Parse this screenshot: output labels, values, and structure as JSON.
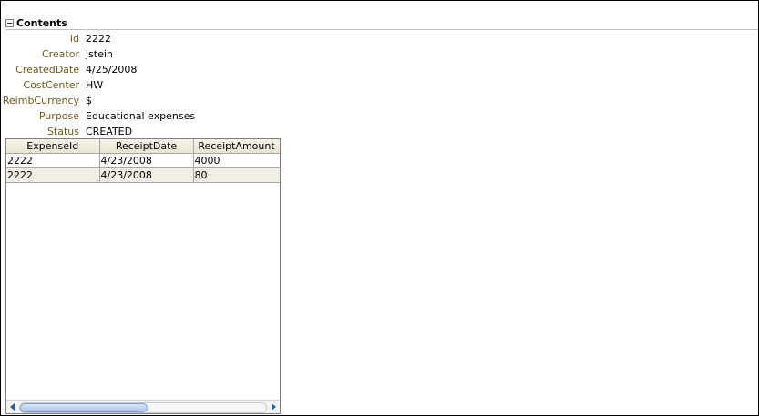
{
  "section": {
    "title": "Contents"
  },
  "fields": [
    {
      "label": "Id",
      "value": "2222"
    },
    {
      "label": "Creator",
      "value": "jstein"
    },
    {
      "label": "CreatedDate",
      "value": "4/25/2008"
    },
    {
      "label": "CostCenter",
      "value": "HW"
    },
    {
      "label": "ReimbCurrency",
      "value": "$"
    },
    {
      "label": "Purpose",
      "value": "Educational expenses"
    },
    {
      "label": "Status",
      "value": "CREATED"
    }
  ],
  "table": {
    "columns": [
      "ExpenseId",
      "ReceiptDate",
      "ReceiptAmount"
    ],
    "rows": [
      [
        "2222",
        "4/23/2008",
        "4000"
      ],
      [
        "2222",
        "4/23/2008",
        "80"
      ]
    ]
  },
  "colors": {
    "label": "#6b5a1e",
    "header_bg": "#ece9d8",
    "alt_row_bg": "#f1efe3",
    "scroll_thumb": "#a9c3ea"
  },
  "icons": {
    "toggle": "collapse-minus-icon",
    "scroll_left": "arrow-left-icon",
    "scroll_right": "arrow-right-icon"
  }
}
